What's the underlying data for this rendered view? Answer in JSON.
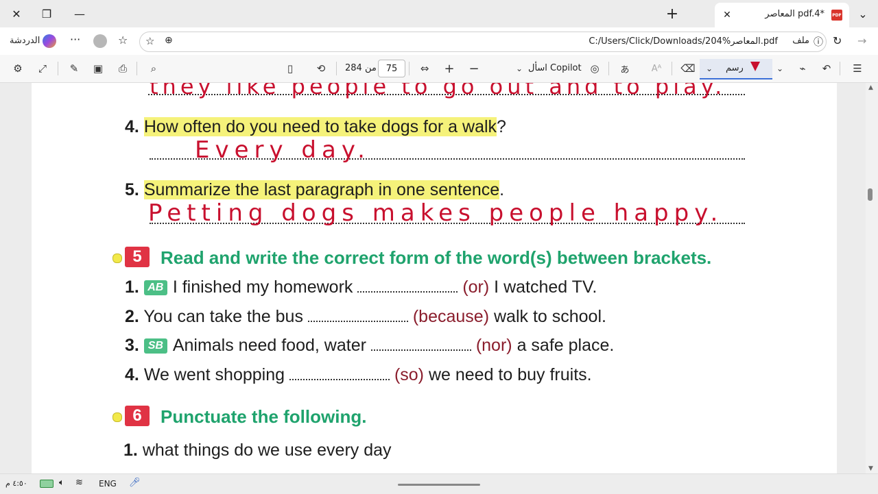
{
  "window": {
    "tab_title": "المعاصر pdf.4*",
    "pdf_badge": "PDF"
  },
  "address": {
    "label": "ملف",
    "url": "C:/Users/Click/Downloads/204%المعاصر.pdf",
    "chat_label": "الدردشة"
  },
  "pdf_toolbar": {
    "page_current": "75",
    "page_of": "من 284",
    "copilot_label": "اسأل Copilot",
    "draw_label": "رسم",
    "draw_color": "#c8102e"
  },
  "document": {
    "handwritten_top": "they like people to go out and to play.",
    "q4": {
      "num": "4.",
      "text": "How often do you need to take dogs for a walk",
      "mark": "?",
      "answer": "Every day."
    },
    "q5": {
      "num": "5.",
      "text": "Summarize the last paragraph in one sentence",
      "mark": ".",
      "answer": "Petting dogs makes people happy."
    },
    "section5": {
      "badge": "5",
      "title": "Read and write the correct form of the word(s) between brackets.",
      "items": [
        {
          "num": "1.",
          "tag": "AB",
          "before": "I finished my homework",
          "bracket": "(or)",
          "after": "I watched TV."
        },
        {
          "num": "2.",
          "tag": "",
          "before": "You can take the bus",
          "bracket": "(because)",
          "after": "walk to school."
        },
        {
          "num": "3.",
          "tag": "SB",
          "before": "Animals need food, water",
          "bracket": "(nor)",
          "after": "a safe place."
        },
        {
          "num": "4.",
          "tag": "",
          "before": "We went shopping",
          "bracket": "(so)",
          "after": "we need to buy fruits."
        }
      ]
    },
    "section6": {
      "badge": "6",
      "title": "Punctuate the following.",
      "items": [
        {
          "num": "1.",
          "text": "what things do we use every day"
        }
      ]
    }
  },
  "taskbar": {
    "language": "ENG",
    "time": "٤:٥٠ م"
  }
}
